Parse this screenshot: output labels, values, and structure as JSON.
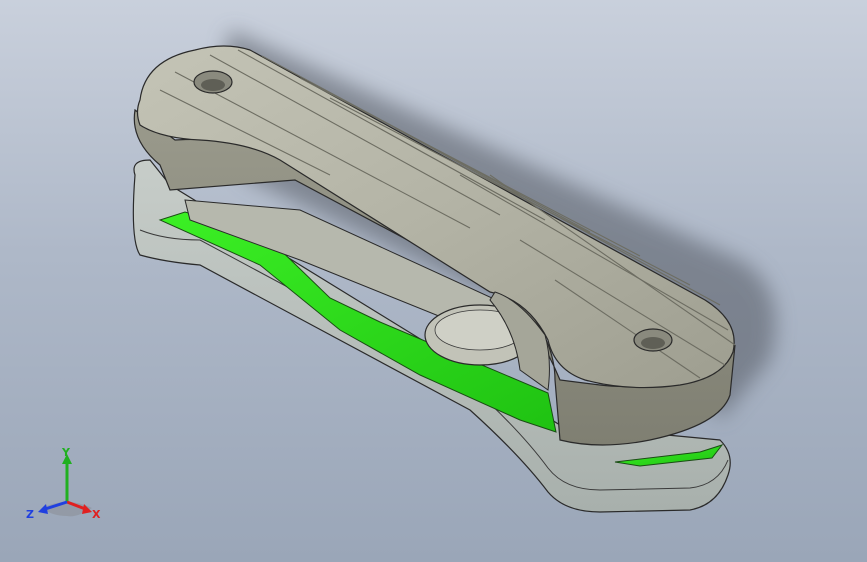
{
  "viewport": {
    "background_top": "#c9d0dc",
    "background_bottom": "#9aa6b8"
  },
  "model": {
    "description_icon": "key-organizer-3d-model",
    "body_color": "#a8a99a",
    "highlight_color": "#2ee81a"
  },
  "triad": {
    "x_label": "X",
    "y_label": "Y",
    "z_label": "Z",
    "x_color": "#e02020",
    "y_color": "#20b020",
    "z_color": "#2040e0"
  }
}
